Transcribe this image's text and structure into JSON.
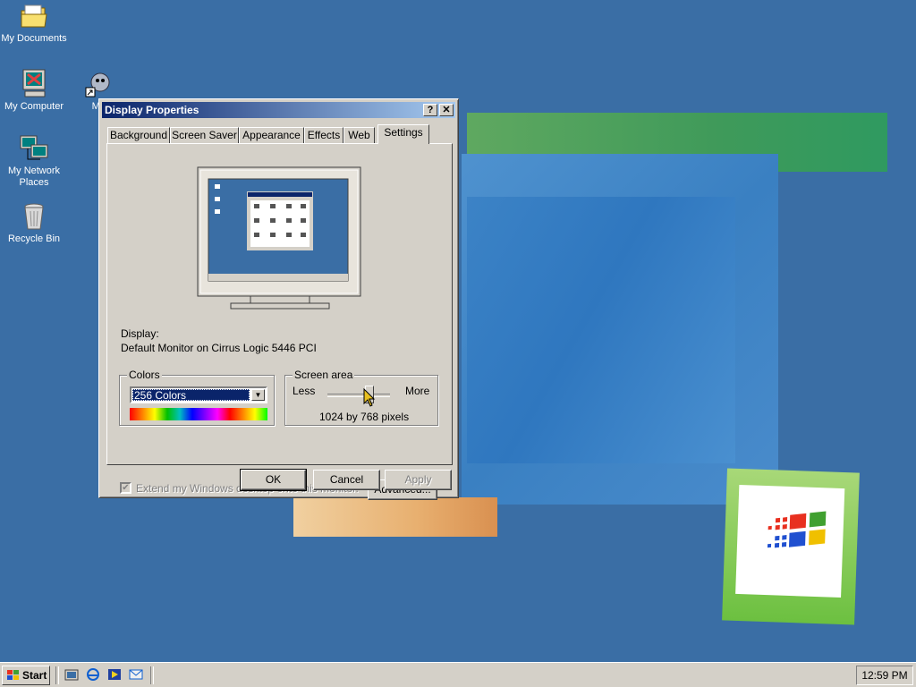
{
  "desktop": {
    "icons": [
      {
        "label": "My Documents"
      },
      {
        "label": "My Computer"
      },
      {
        "label": "My Network Places"
      },
      {
        "label": "Recycle Bin"
      },
      {
        "label": "My"
      }
    ]
  },
  "dialog": {
    "title": "Display Properties",
    "help_glyph": "?",
    "close_glyph": "✕",
    "tabs": [
      "Background",
      "Screen Saver",
      "Appearance",
      "Effects",
      "Web",
      "Settings"
    ],
    "active_tab": "Settings",
    "display_label": "Display:",
    "display_value": "Default Monitor on Cirrus Logic 5446 PCI",
    "colors": {
      "legend": "Colors",
      "selected": "256 Colors"
    },
    "screen_area": {
      "legend": "Screen area",
      "less": "Less",
      "more": "More",
      "value": "1024 by 768 pixels",
      "slider_fraction": 0.67
    },
    "extend_checkbox": {
      "label": "Extend my Windows desktop onto this monitor.",
      "checked": true,
      "enabled": false
    },
    "advanced_button": "Advanced...",
    "ok_button": "OK",
    "cancel_button": "Cancel",
    "apply_button": "Apply"
  },
  "taskbar": {
    "start_label": "Start",
    "clock": "12:59 PM"
  },
  "colors": {
    "desktop_bg": "#3a6ea5",
    "titlebar_start": "#0a246a",
    "titlebar_end": "#a6caf0",
    "face": "#d4d0c8"
  }
}
